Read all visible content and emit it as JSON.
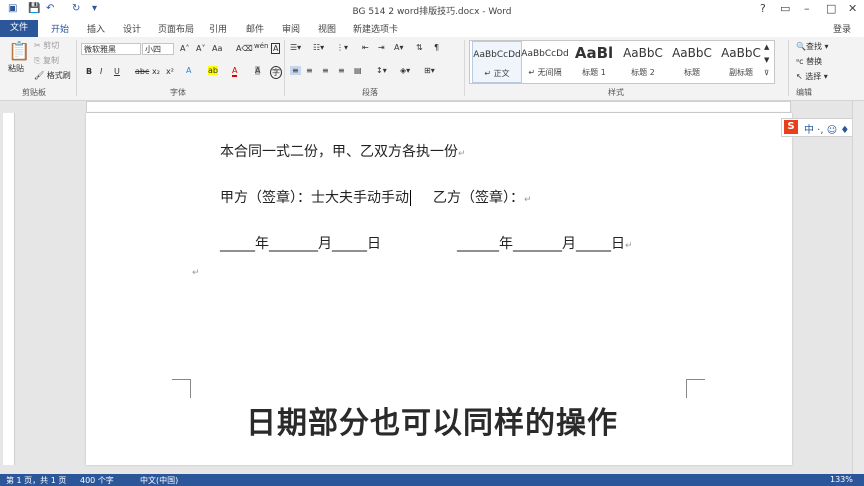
{
  "window": {
    "title": "BG 514 2 word排版技巧.docx - Word",
    "login": "登录"
  },
  "tabs": {
    "file": "文件",
    "items": [
      "开始",
      "插入",
      "设计",
      "页面布局",
      "引用",
      "邮件",
      "审阅",
      "视图",
      "新建选项卡"
    ]
  },
  "ribbon": {
    "clipboard": {
      "paste": "粘贴",
      "cut": "剪切",
      "copy": "复制",
      "format_painter": "格式刷",
      "label": "剪贴板"
    },
    "font": {
      "name": "微软雅黑",
      "size": "小四",
      "label": "字体",
      "bold": "B",
      "italic": "I",
      "underline": "U",
      "strike": "abc",
      "sub": "x₂",
      "sup": "x²",
      "wen": "wén"
    },
    "paragraph": {
      "label": "段落"
    },
    "styles": {
      "label": "样式",
      "items": [
        {
          "sample": "AaBbCcDd",
          "name": "↵ 正文"
        },
        {
          "sample": "AaBbCcDd",
          "name": "↵ 无间隔"
        },
        {
          "sample": "AaBl",
          "name": "标题 1"
        },
        {
          "sample": "AaBbC",
          "name": "标题 2"
        },
        {
          "sample": "AaBbC",
          "name": "标题"
        },
        {
          "sample": "AaBbC",
          "name": "副标题"
        }
      ]
    },
    "editing": {
      "find": "查找",
      "replace": "替换",
      "select": "选择",
      "label": "编辑"
    }
  },
  "document": {
    "line1": "本合同一式二份，甲、乙双方各执一份",
    "line2_left": "甲方（签章）：士大夫手动手动",
    "line2_right": "乙方（签章）：",
    "date_left": "_____年_______月_____日",
    "date_right": "______年_______月_____日",
    "pilcrow": "↵"
  },
  "ime": {
    "logo": "S",
    "text": "中 ·, ☺ ♦"
  },
  "subtitle": "日期部分也可以同样的操作",
  "status": {
    "page": "第 1 页，共 1 页",
    "words": "400 个字",
    "language": "中文(中国)",
    "zoom": "133%"
  },
  "colors": {
    "accent": "#2b579a",
    "ribbon": "#f3f3f3"
  }
}
